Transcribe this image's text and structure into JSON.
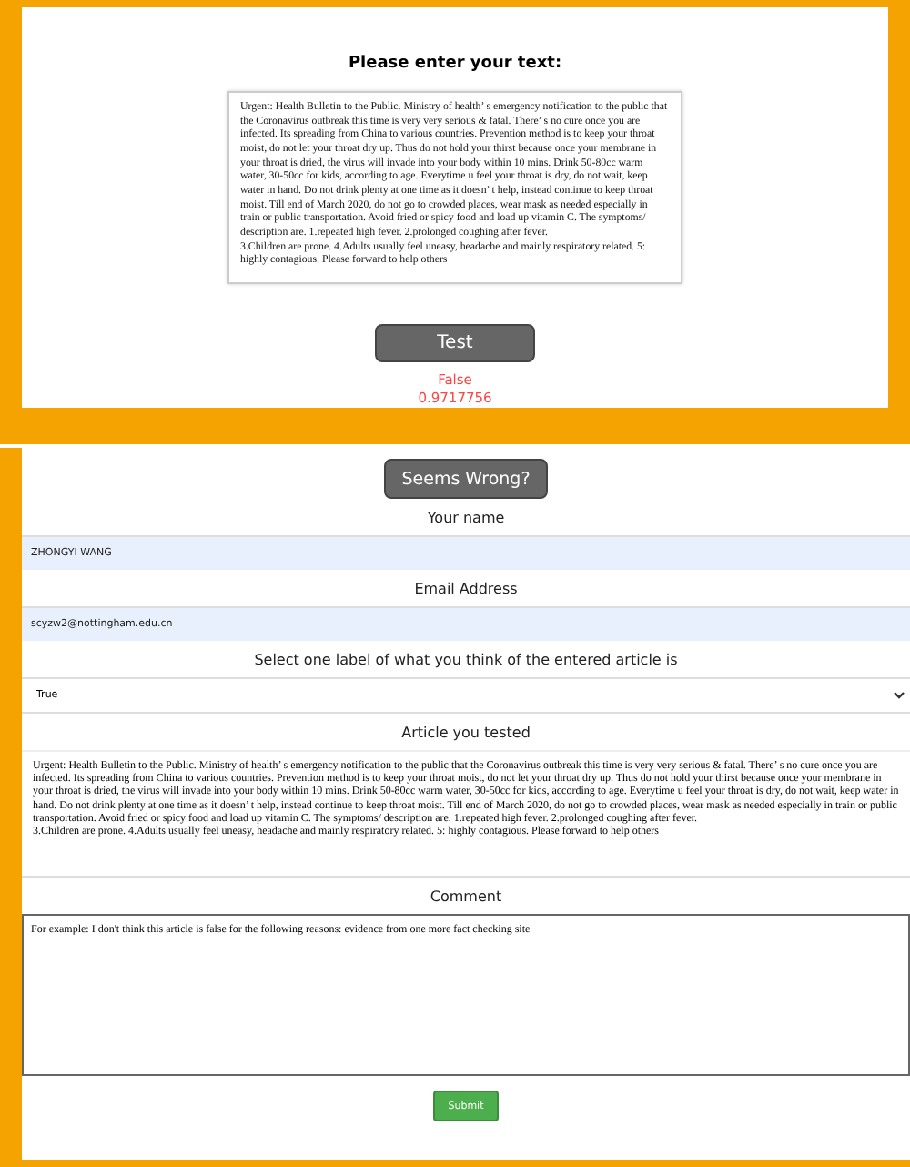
{
  "test_panel": {
    "heading": "Please enter your text:",
    "article": "Urgent: Health Bulletin to the Public. Ministry of health’ s emergency notification to the public that the Coronavirus outbreak this time is very very serious & fatal. There’ s no cure once you are infected. Its spreading from China to various countries. Prevention method is to keep your throat moist, do not let your throat dry up. Thus do not hold your thirst because once your membrane in your throat is dried, the virus will invade into your body within 10 mins. Drink 50-80cc warm water, 30-50cc for kids, according to age. Everytime u feel your throat is dry, do not wait, keep water in hand. Do not drink plenty at one time as it doesn’ t help, instead continue to keep throat moist. Till end of March 2020, do not go to crowded places, wear mask as needed especially in train or public transportation. Avoid fried or spicy food and load up vitamin C. The symptoms/ description are. 1.repeated high fever. 2.prolonged coughing after fever.\n3.Children are prone. 4.Adults usually feel uneasy, headache and mainly respiratory related. 5: highly contagious. Please forward to help others",
    "button": "Test",
    "result_label": "False",
    "result_score": "0.9717756"
  },
  "feedback_panel": {
    "toggle_button": "Seems Wrong?",
    "fields": [
      {
        "kind": "input",
        "label": "Your name",
        "value": "ZHONGYI WANG"
      },
      {
        "kind": "input",
        "label": "Email Address",
        "value": "scyzw2@nottingham.edu.cn"
      },
      {
        "kind": "select",
        "label": "Select one label of what you think of the entered article is",
        "value": "True"
      },
      {
        "kind": "textarea",
        "label": "Article you tested",
        "value": "Urgent: Health Bulletin to the Public. Ministry of health’ s emergency notification to the public that the Coronavirus outbreak this time is very very serious & fatal. There’ s no cure once you are infected. Its spreading from China to various countries. Prevention method is to keep your throat moist, do not let your throat dry up. Thus do not hold your thirst because once your membrane in your throat is dried, the virus will invade into your body within 10 mins. Drink 50-80cc warm water, 30-50cc for kids, according to age. Everytime u feel your throat is dry, do not wait, keep water in hand. Do not drink plenty at one time as it doesn’ t help, instead continue to keep throat moist. Till end of March 2020, do not go to crowded places, wear mask as needed especially in train or public transportation. Avoid fried or spicy food and load up vitamin C. The symptoms/ description are. 1.repeated high fever. 2.prolonged coughing after fever.\n3.Children are prone. 4.Adults usually feel uneasy, headache and mainly respiratory related. 5: highly contagious. Please forward to help others"
      },
      {
        "kind": "comment",
        "label": "Comment",
        "value": "For example: I don't think this article is false for the following reasons: evidence from one more fact checking site"
      }
    ],
    "submit": "Submit"
  }
}
